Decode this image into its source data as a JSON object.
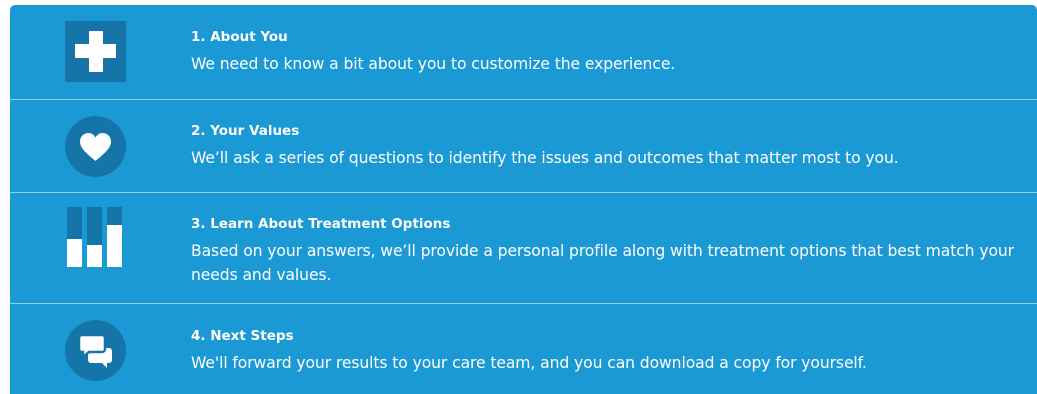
{
  "colors": {
    "panel_bg": "#1b99d5",
    "icon_dark": "#1675a8",
    "divider": "#8fd0ee",
    "text": "#ffffff"
  },
  "steps": [
    {
      "icon": "medical-cross-icon",
      "title": "1. About You",
      "description": "We need to know a bit about you to customize the experience."
    },
    {
      "icon": "heart-icon",
      "title": "2. Your Values",
      "description": "We’ll ask a series of questions to identify the issues and outcomes that matter most to you."
    },
    {
      "icon": "bar-chart-icon",
      "title": "3. Learn About Treatment Options",
      "description": "Based on your answers, we’ll provide a personal profile along with treatment options that best match your needs and values."
    },
    {
      "icon": "chat-bubbles-icon",
      "title": "4. Next Steps",
      "description": "We'll forward your results to your care team, and you can download a copy for yourself."
    }
  ]
}
